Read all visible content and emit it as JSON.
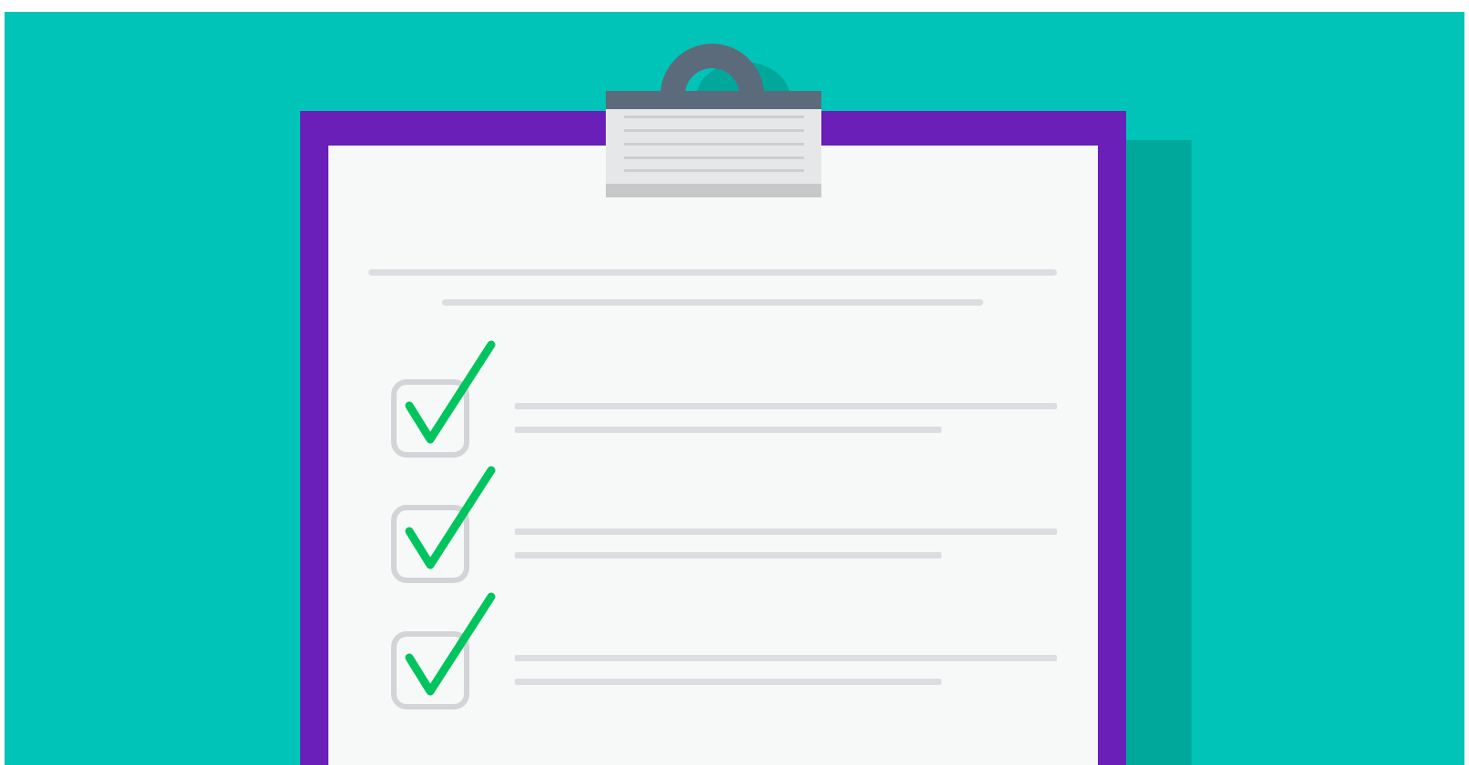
{
  "illustration": {
    "subject": "clipboard-checklist",
    "colors": {
      "background": "#00C4B8",
      "shadow": "#00A89C",
      "board": "#6A1FB8",
      "paper": "#F7F8F8",
      "clip_ring": "#5B6B7C",
      "clip_plate": "#E6E7E8",
      "clip_plate_bottom": "#C7C8CA",
      "clip_plate_lines": "#CDCED1",
      "text_lines": "#DCDDE1",
      "checkbox_border": "#D3D4D8",
      "checkmark": "#00C45E"
    },
    "checklist": {
      "items": [
        {
          "checked": true
        },
        {
          "checked": true
        },
        {
          "checked": true
        }
      ]
    }
  }
}
